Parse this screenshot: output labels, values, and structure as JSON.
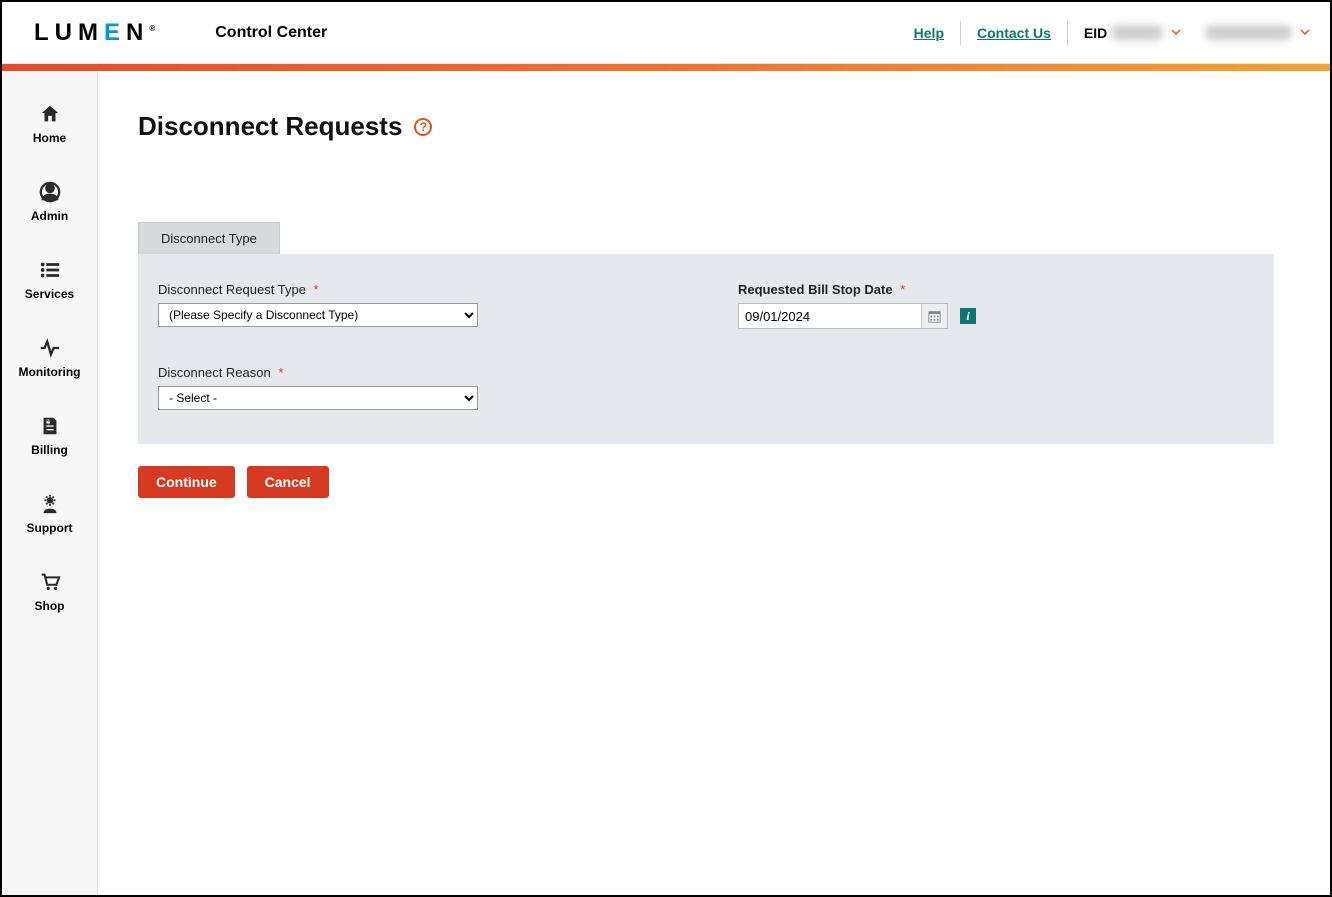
{
  "header": {
    "logo_prefix": "LUM",
    "logo_accent": "E",
    "logo_suffix": "N",
    "logo_mark": "®",
    "app_title": "Control Center",
    "help_label": "Help",
    "contact_label": "Contact Us",
    "eid_label": "EID"
  },
  "sidebar": {
    "items": [
      {
        "label": "Home"
      },
      {
        "label": "Admin"
      },
      {
        "label": "Services"
      },
      {
        "label": "Monitoring"
      },
      {
        "label": "Billing"
      },
      {
        "label": "Support"
      },
      {
        "label": "Shop"
      }
    ]
  },
  "page": {
    "title": "Disconnect Requests",
    "help_glyph": "?"
  },
  "form": {
    "tab_label": "Disconnect Type",
    "request_type": {
      "label": "Disconnect Request Type",
      "selected": "(Please Specify a Disconnect Type)"
    },
    "reason": {
      "label": "Disconnect Reason",
      "selected": "- Select -"
    },
    "bill_stop": {
      "label": "Requested Bill Stop Date",
      "value": "09/01/2024",
      "info_glyph": "i"
    },
    "required_mark": "*"
  },
  "buttons": {
    "continue_label": "Continue",
    "cancel_label": "Cancel"
  }
}
